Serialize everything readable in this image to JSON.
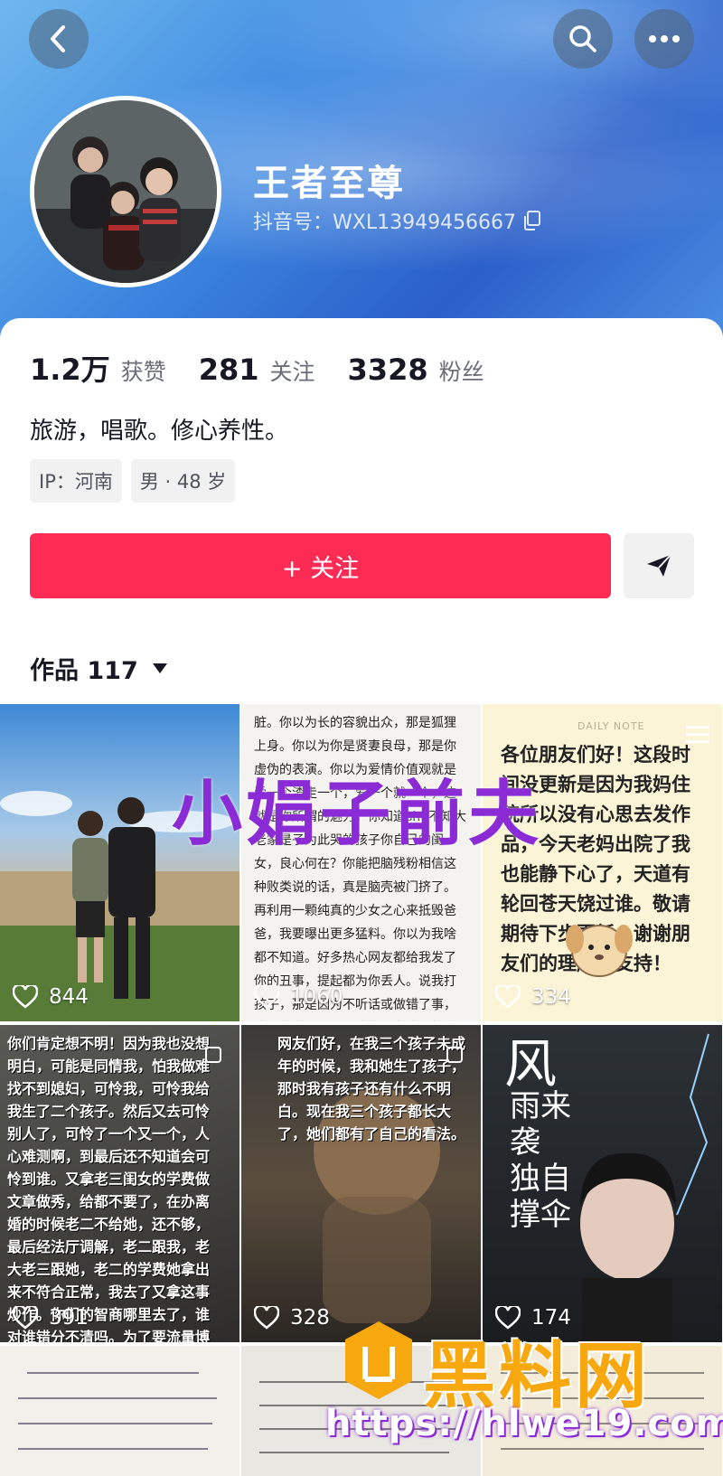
{
  "profile": {
    "name": "王者至尊",
    "douyin_id": "抖音号：WXL13949456667",
    "bio": "旅游，唱歌。修心养性。"
  },
  "stats": [
    {
      "num": "1.2万",
      "label": "获赞"
    },
    {
      "num": "281",
      "label": "关注"
    },
    {
      "num": "3328",
      "label": "粉丝"
    }
  ],
  "tags": [
    "IP：河南",
    "男 · 48 岁"
  ],
  "actions": {
    "follow_label": "+ 关注"
  },
  "works": {
    "label": "作品 117"
  },
  "tiles": [
    {
      "likes": "844"
    },
    {
      "likes": "1060",
      "text": "脏。你以为长的容貌出众，那是狐狸上身。你以为你是贤妻良母，那是你虚伪的表演。你以为爱情价值观就是爱一个渣走一个，爱一个就一个，这就是你所谓的魅力。你知道shu不知大老家是子为此哭的孩子你自己的闺女，良心何在？你能把脑残粉相信这种败类说的话，真是脑壳被门挤了。再利用一颗纯真的少女之心来抵毁爸爸，我要曝出更多猛料。你以为我啥都不知道。好多热心网友都给我发了你的丑事，提起都为你丢人。说我打孩子，那是因为不听话或做错了事，这是做为父母望子成龙望女成凤的教育方式，有错吗。就是因为你小时候没挨过打成就了现在的你。无道德，无底线，无素质，无教养，难道你要遗传给孩子吗，但凡你有点人性也不以把闺女当成人看。有本事做丢人的事，你就没胆量敢承认，老让一个十五六岁的孩子说出这种话。"
    },
    {
      "likes": "334",
      "note": "DAILY NOTE",
      "text": "各位朋友们好！这段时间没更新是因为我妈住院所以没有心思去发作品，今天老妈出院了我也能静下心了，天道有轮回苍天饶过谁。敬请期待下步更新。谢谢朋友们的理解和支持！"
    },
    {
      "likes": "391",
      "text": "你们肯定想不明！因为我也没想明白，可能是同情我，怕我做难找不到媳妇，可怜我，可怜我给我生了二个孩子。然后又去可怜别人了，可怜了一个又一个，人心难测啊，到最后还不知道会可怜到谁。又拿老三闺女的学费做文章做秀，给都不要了，在办离婚的时候老二不给她，还不够，最后经法厅调解，老二跟我，老大老三跟她，老二的学费她拿出来不符合正常，我去了又拿这事炒作。你们的智商哪里去了，谁对谁错分不清吗。为了要流量博同情找的男人无数，就连孩子也成了她立人设的工具。瞎话张嘴就来，这就是你们所支持的贤妻良母，有的还大言不惭的说笑贫不笑娼，可笑之极，那你们也可以去找大难的男人，也不枉你们来世上走一回。"
    },
    {
      "likes": "328",
      "text": "网友们好，在我三个孩子未成年的时候，我和她生了孩子，那时我有孩子还有什么不明白。现在我三个孩子都长大了，她们都有了自己的看法。"
    },
    {
      "likes": "174",
      "title_big": "风",
      "poem": "雨来袭 独自撑伞"
    }
  ],
  "overlays": {
    "headline": "小娟子前夫",
    "watermark": "黑料网",
    "watermark_url": "https://hlwe19.com"
  },
  "colors": {
    "accent": "#fe2c55",
    "headline": "#8a2bd6",
    "watermark": "#f8a80f"
  }
}
